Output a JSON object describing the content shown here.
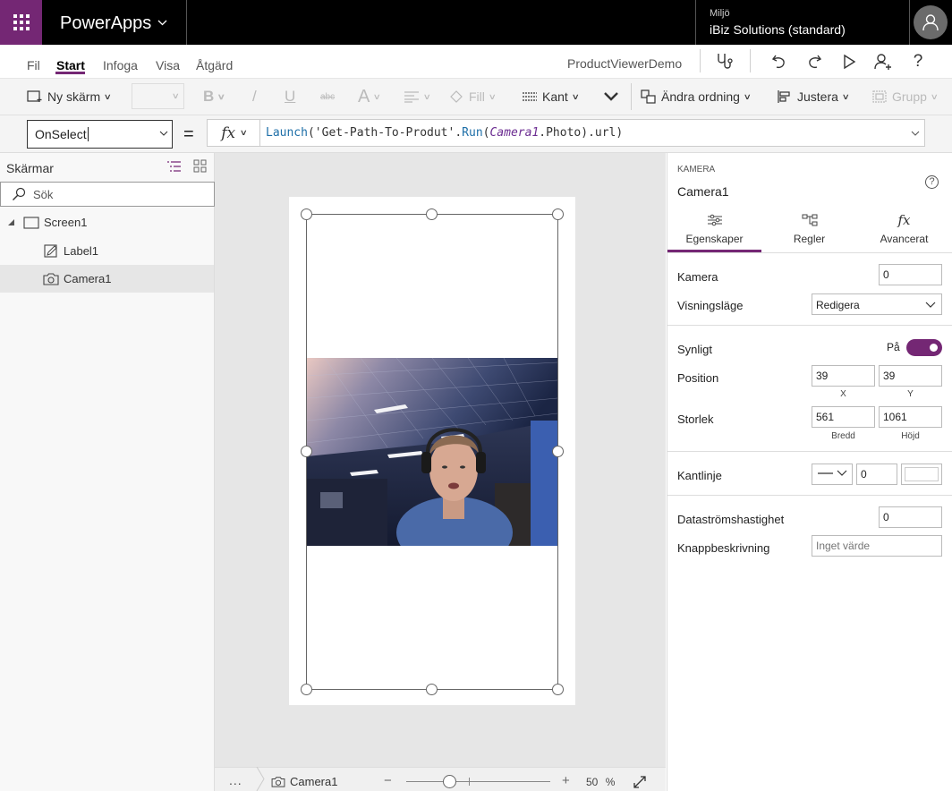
{
  "app": {
    "name": "PowerApps",
    "environment_label": "Miljö",
    "environment_name": "iBiz Solutions (standard)",
    "document_name": "ProductViewerDemo"
  },
  "menu": {
    "items": [
      "Fil",
      "Start",
      "Infoga",
      "Visa",
      "Åtgärd"
    ],
    "active": "Start"
  },
  "ribbon": {
    "new_screen": "Ny skärm",
    "bold": "B",
    "italic": "/",
    "underline": "U",
    "strike": "abc",
    "font_color": "A",
    "fill": "Fill",
    "border": "Kant",
    "reorder": "Ändra ordning",
    "align": "Justera",
    "group": "Grupp"
  },
  "formula_bar": {
    "property": "OnSelect",
    "equals": "=",
    "fx": "fx",
    "formula_parts": {
      "fn1": "Launch",
      "open1": "(",
      "str": "'Get-Path-To-Produt'",
      "dot1": ".",
      "fn2": "Run",
      "open2": "(",
      "id": "Camera1",
      "rest": ".Photo).url)"
    }
  },
  "left_panel": {
    "title": "Skärmar",
    "search_placeholder": "Sök",
    "tree": [
      {
        "label": "Screen1",
        "type": "screen"
      },
      {
        "label": "Label1",
        "type": "label"
      },
      {
        "label": "Camera1",
        "type": "camera",
        "selected": true
      }
    ]
  },
  "bottom_bar": {
    "more": "...",
    "selected_control": "Camera1",
    "zoom_minus": "−",
    "zoom_plus": "+",
    "zoom_value": "50",
    "zoom_unit": "%",
    "zoom_fraction": 0.3
  },
  "properties": {
    "type_label": "KAMERA",
    "control_name": "Camera1",
    "tabs": [
      "Egenskaper",
      "Regler",
      "Avancerat"
    ],
    "active_tab": "Egenskaper",
    "camera_label": "Kamera",
    "camera_value": "0",
    "display_mode_label": "Visningsläge",
    "display_mode_value": "Redigera",
    "visible_label": "Synligt",
    "visible_state": "På",
    "position_label": "Position",
    "position_x": "39",
    "position_y": "39",
    "x_caption": "X",
    "y_caption": "Y",
    "size_label": "Storlek",
    "width": "561",
    "height": "1061",
    "width_caption": "Bredd",
    "height_caption": "Höjd",
    "border_label": "Kantlinje",
    "border_width": "0",
    "stream_rate_label": "Dataströmshastighet",
    "stream_rate_value": "0",
    "button_desc_label": "Knappbeskrivning",
    "button_desc_placeholder": "Inget värde"
  },
  "colors": {
    "accent": "#742774",
    "topbar": "#000000",
    "ribbon": "#f4f4f4",
    "canvas": "#e6e6e6"
  }
}
